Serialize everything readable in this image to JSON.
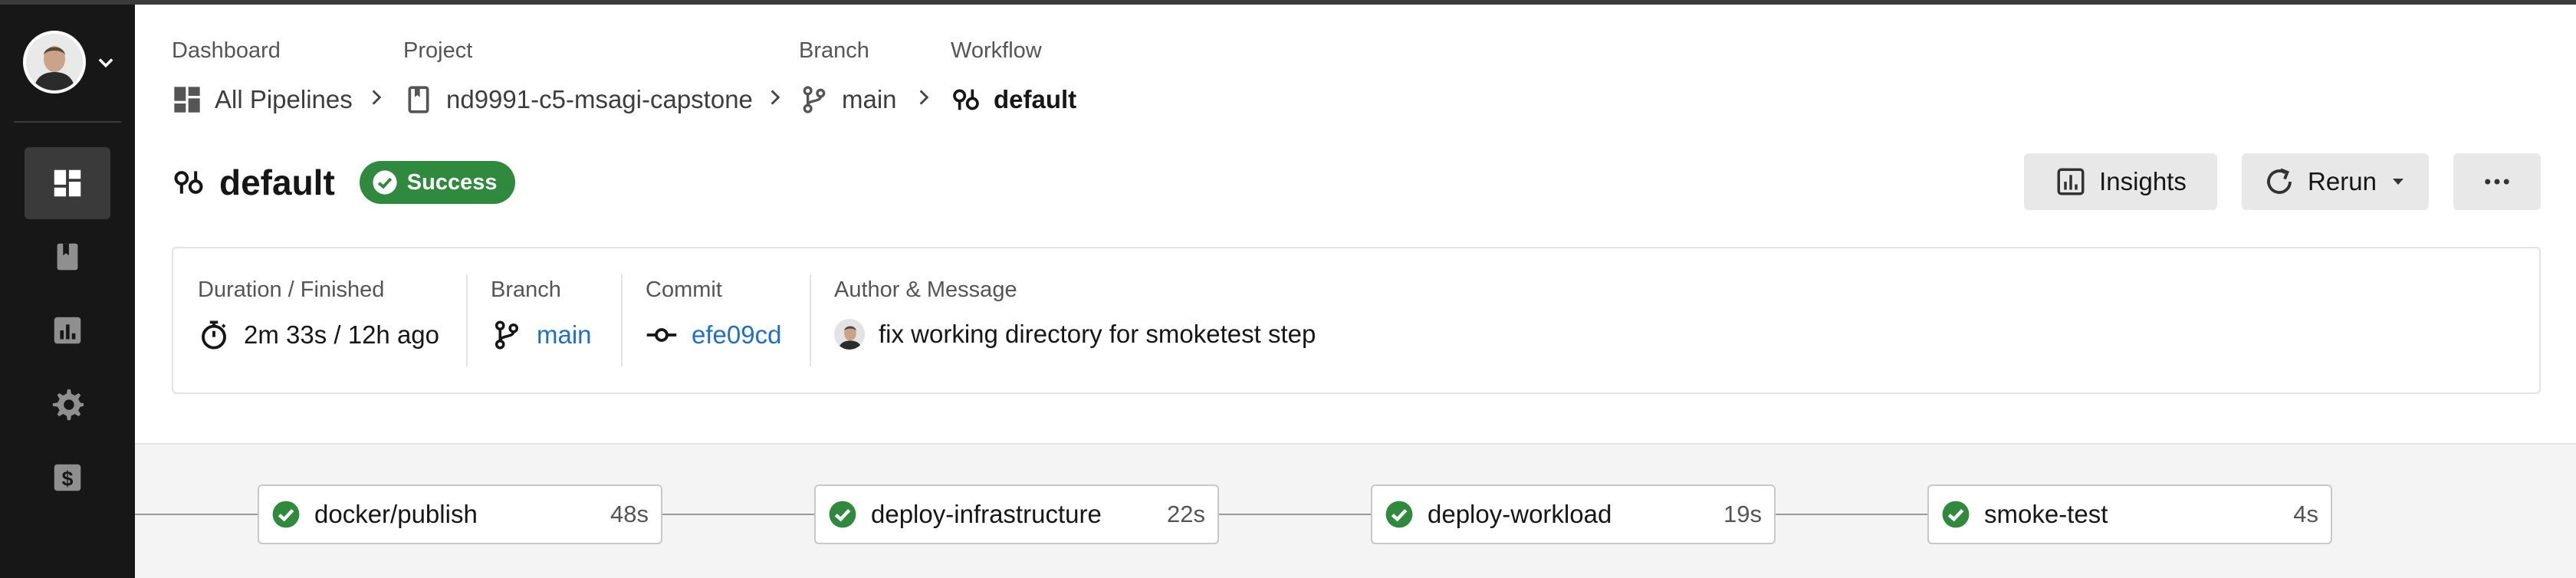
{
  "breadcrumbs": [
    {
      "label": "Dashboard",
      "value": "All Pipelines",
      "icon": "dashboard-icon"
    },
    {
      "label": "Project",
      "value": "nd9991-c5-msagi-capstone",
      "icon": "bookmark-icon"
    },
    {
      "label": "Branch",
      "value": "main",
      "icon": "branch-icon"
    },
    {
      "label": "Workflow",
      "value": "default",
      "icon": "workflow-icon"
    }
  ],
  "header": {
    "title": "default",
    "status": "Success",
    "actions": {
      "insights": "Insights",
      "rerun": "Rerun"
    }
  },
  "info": {
    "duration": {
      "label": "Duration / Finished",
      "value": "2m 33s / 12h ago"
    },
    "branch": {
      "label": "Branch",
      "value": "main"
    },
    "commit": {
      "label": "Commit",
      "value": "efe09cd"
    },
    "author": {
      "label": "Author & Message",
      "message": "fix working directory for smoketest step"
    }
  },
  "jobs": [
    {
      "name": "docker/publish",
      "duration": "48s",
      "status": "success"
    },
    {
      "name": "deploy-infrastructure",
      "duration": "22s",
      "status": "success"
    },
    {
      "name": "deploy-workload",
      "duration": "19s",
      "status": "success"
    },
    {
      "name": "smoke-test",
      "duration": "4s",
      "status": "success"
    }
  ],
  "colors": {
    "success": "#2f8a3d",
    "link": "#1f6fc7",
    "sidebar": "#171717"
  }
}
